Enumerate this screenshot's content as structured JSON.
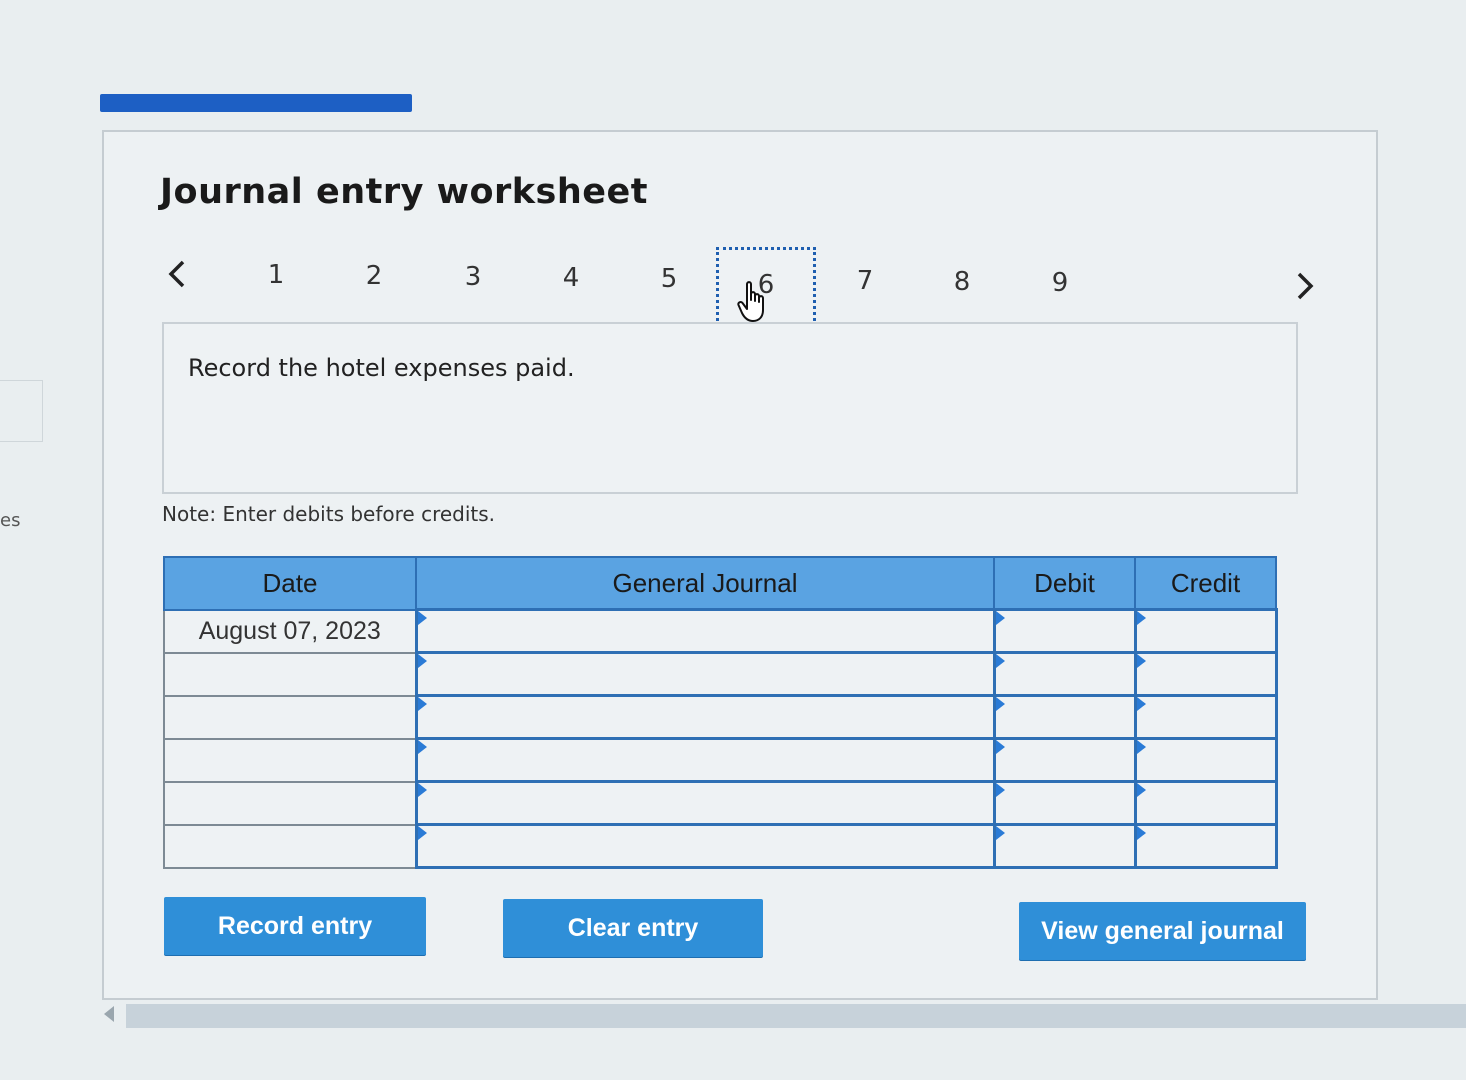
{
  "side_label": "es",
  "title": "Journal entry worksheet",
  "pager": {
    "pages": [
      "1",
      "2",
      "3",
      "4",
      "5",
      "6",
      "7",
      "8",
      "9"
    ],
    "active": "6"
  },
  "prompt": "Record the hotel expenses paid.",
  "note": "Note: Enter debits before credits.",
  "table": {
    "headers": {
      "date": "Date",
      "journal": "General Journal",
      "debit": "Debit",
      "credit": "Credit"
    },
    "rows": [
      {
        "date": "August 07, 2023",
        "account": "",
        "debit": "",
        "credit": ""
      },
      {
        "date": "",
        "account": "",
        "debit": "",
        "credit": ""
      },
      {
        "date": "",
        "account": "",
        "debit": "",
        "credit": ""
      },
      {
        "date": "",
        "account": "",
        "debit": "",
        "credit": ""
      },
      {
        "date": "",
        "account": "",
        "debit": "",
        "credit": ""
      },
      {
        "date": "",
        "account": "",
        "debit": "",
        "credit": ""
      }
    ]
  },
  "buttons": {
    "record": "Record entry",
    "clear": "Clear entry",
    "view": "View general journal"
  },
  "colors": {
    "accent": "#2f8fd8",
    "header": "#5aa3e2",
    "border": "#2e6fb4",
    "top_bar": "#1d5fc4"
  },
  "icons": {
    "prev": "chevron-left-icon",
    "next": "chevron-right-icon",
    "cursor": "hand-pointer-icon"
  }
}
